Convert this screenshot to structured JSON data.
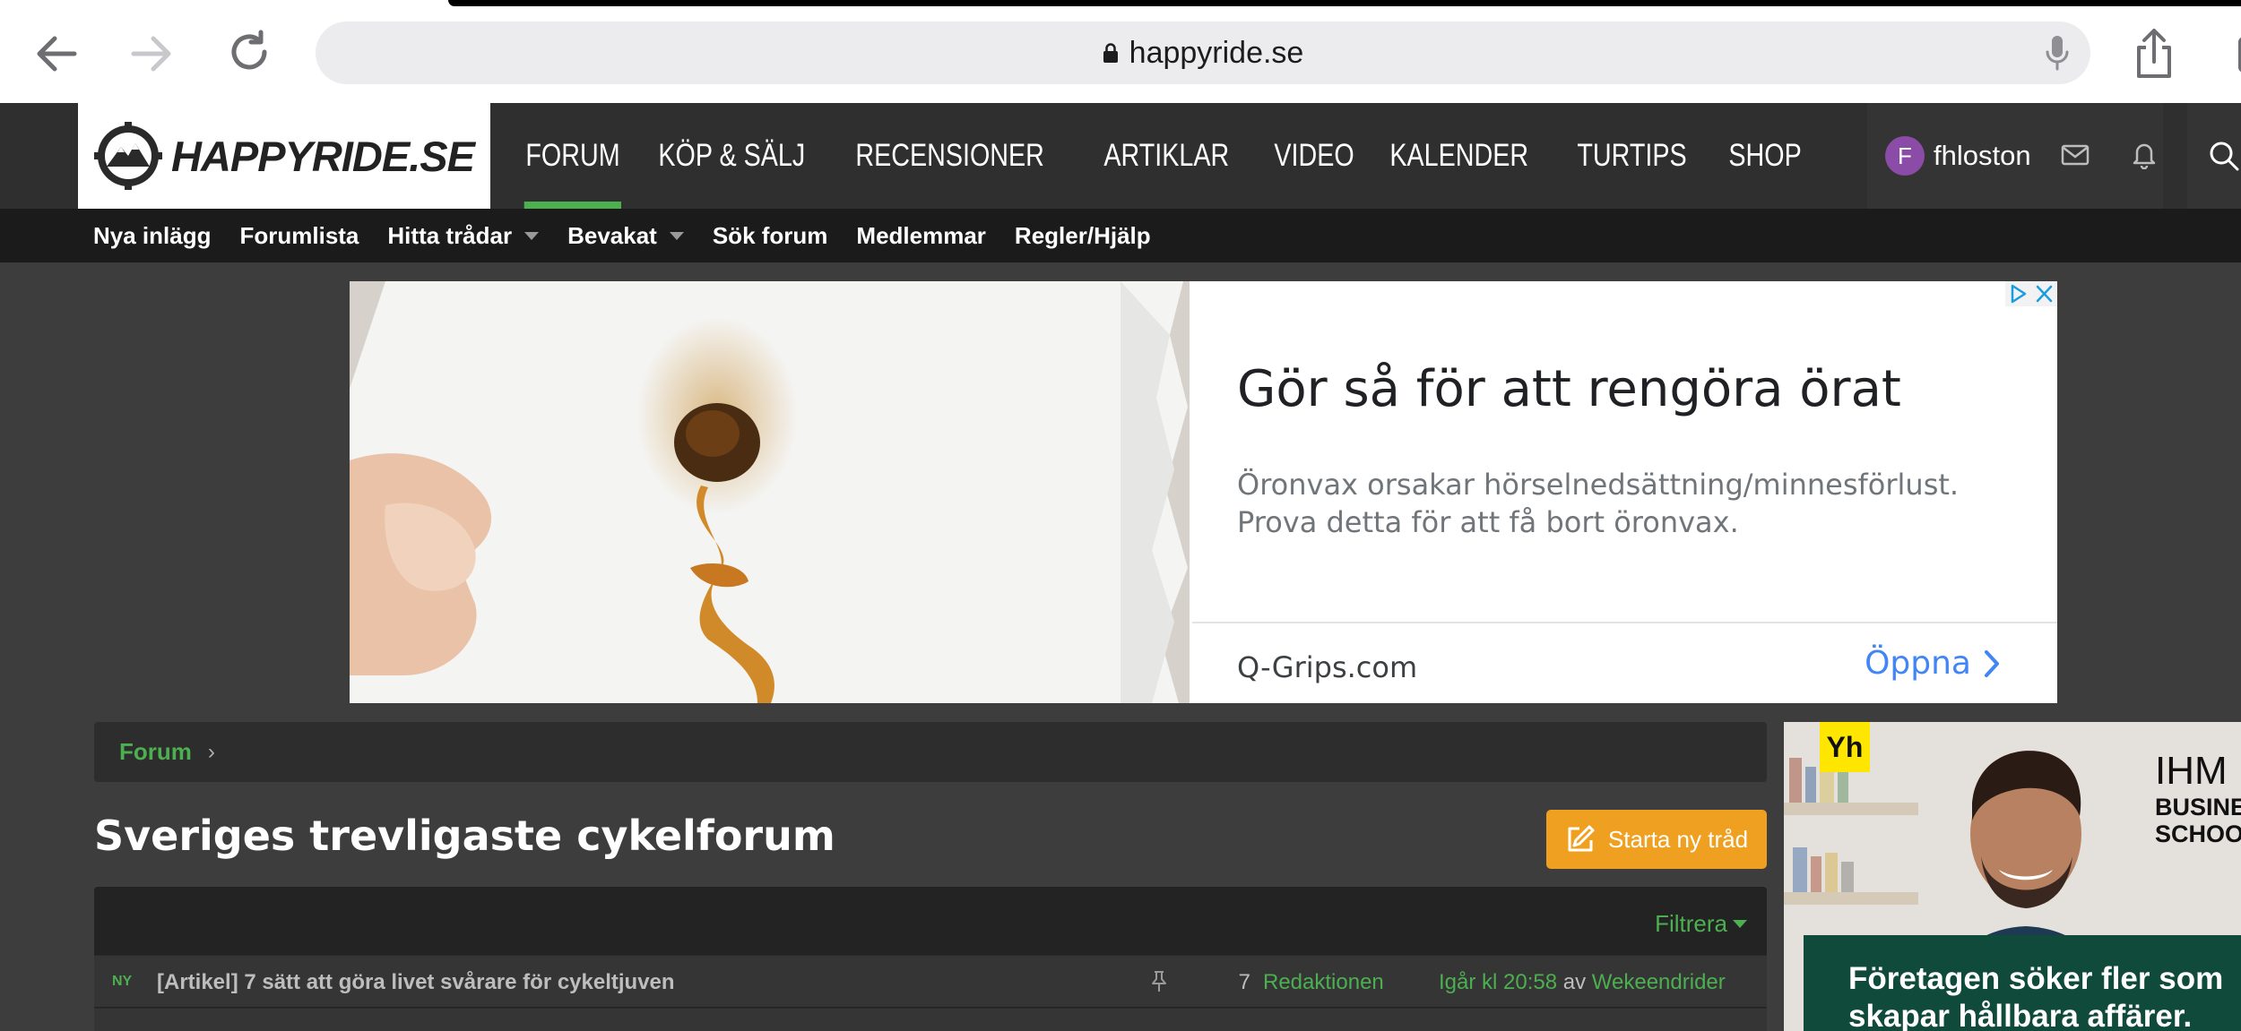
{
  "browser": {
    "url": "happyride.se"
  },
  "site": {
    "logo_text": "HAPPYRIDE.SE",
    "nav": [
      {
        "label": "FORUM",
        "active": true
      },
      {
        "label": "KÖP & SÄLJ"
      },
      {
        "label": "RECENSIONER"
      },
      {
        "label": "ARTIKLAR"
      },
      {
        "label": "VIDEO"
      },
      {
        "label": "KALENDER"
      },
      {
        "label": "TURTIPS"
      },
      {
        "label": "SHOP"
      }
    ],
    "user": {
      "initial": "F",
      "name": "fhloston"
    }
  },
  "sub_nav": [
    {
      "label": "Nya inlägg"
    },
    {
      "label": "Forumlista"
    },
    {
      "label": "Hitta trådar"
    },
    {
      "label": "Bevakat"
    },
    {
      "label": "Sök forum"
    },
    {
      "label": "Medlemmar"
    },
    {
      "label": "Regler/Hjälp"
    }
  ],
  "ad": {
    "title": "Gör så för att rengöra örat",
    "desc_line1": "Öronvax orsakar hörselnedsättning/minnesförlust.",
    "desc_line2": "Prova detta för att få bort öronvax.",
    "domain": "Q-Grips.com",
    "cta": "Öppna"
  },
  "breadcrumb": {
    "forum": "Forum",
    "sep": "›"
  },
  "page": {
    "title": "Sveriges trevligaste cykelforum",
    "new_thread": "Starta ny tråd"
  },
  "threads": {
    "filter": "Filtrera",
    "rows": [
      {
        "badge": "NY",
        "title": "[Artikel] 7 sätt att göra livet svårare för cykeltjuven",
        "count": "7",
        "author": "Redaktionen",
        "last_time": "Igår kl 20:58",
        "by": "av",
        "last_user": "Wekeendrider"
      }
    ]
  },
  "side_ad": {
    "badge": "Yh",
    "brand": "IHM",
    "brand_sub1": "BUSINE",
    "brand_sub2": "SCHOO",
    "text_line1": "Företagen söker fler som",
    "text_line2": "skapar hållbara affärer."
  },
  "colors": {
    "accent_green": "#4caf50",
    "accent_orange": "#f0a020",
    "header_bg": "#2f2f2f",
    "page_bg": "#3d3d3d"
  }
}
